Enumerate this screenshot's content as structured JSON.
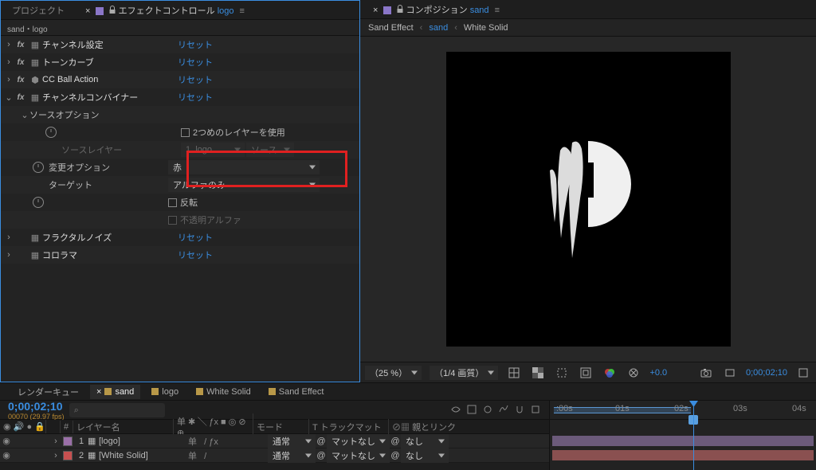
{
  "tabs": {
    "project": "プロジェクト",
    "effect_controls": "エフェクトコントロール",
    "effect_controls_target": "logo"
  },
  "breadcrumb": "sand・logo",
  "effects": {
    "channel_settings": {
      "name": "チャンネル設定",
      "reset": "リセット"
    },
    "tone_curve": {
      "name": "トーンカーブ",
      "reset": "リセット"
    },
    "cc_ball": {
      "name": "CC Ball Action",
      "reset": "リセット"
    },
    "channel_combiner": {
      "name": "チャンネルコンバイナー",
      "reset": "リセット"
    },
    "source_options": "ソースオプション",
    "use_second_layer": "2つめのレイヤーを使用",
    "source_layer": "ソースレイヤー",
    "source_layer_val": "1. logo",
    "source_dd": "ソース",
    "change_option": "変更オプション",
    "change_option_val": "赤",
    "target": "ターゲット",
    "target_val": "アルファのみ",
    "invert": "反転",
    "opaque_alpha": "不透明アルファ",
    "fractal_noise": {
      "name": "フラクタルノイズ",
      "reset": "リセット"
    },
    "colorama": {
      "name": "コロラマ",
      "reset": "リセット"
    }
  },
  "comp_panel": {
    "title": "コンポジション",
    "comp_name": "sand",
    "bc_comp1": "Sand Effect",
    "bc_comp2": "sand",
    "bc_comp3": "White Solid"
  },
  "viewer_toolbar": {
    "zoom": "（25 %）",
    "quality": "（1/4 画質）",
    "exposure": "+0.0",
    "time": "0;00;02;10"
  },
  "timeline": {
    "tab_render": "レンダーキュー",
    "tab_sand": "sand",
    "tab_logo": "logo",
    "tab_white": "White Solid",
    "tab_sfx": "Sand Effect",
    "timecode": "0;00;02;10",
    "fps": "00070 (29.97 fps)",
    "col_index": "#",
    "col_name": "レイヤー名",
    "col_switches": "单 ✱ ╲ ƒx  ■ ◎ ⊘ ⊕",
    "col_mode": "モード",
    "col_trkmat_h": "T トラックマット",
    "col_parent": "親とリンク",
    "layer1": {
      "idx": "1",
      "name": "[logo]",
      "mode": "通常",
      "trkmat": "マットなし",
      "parent": "なし"
    },
    "layer2": {
      "idx": "2",
      "name": "[White Solid]",
      "mode": "通常",
      "trkmat": "マットなし",
      "parent": "なし"
    },
    "ruler": {
      "t0": ":00s",
      "t1": "01s",
      "t2": "02s",
      "t3": "03s",
      "t4": "04s"
    }
  }
}
